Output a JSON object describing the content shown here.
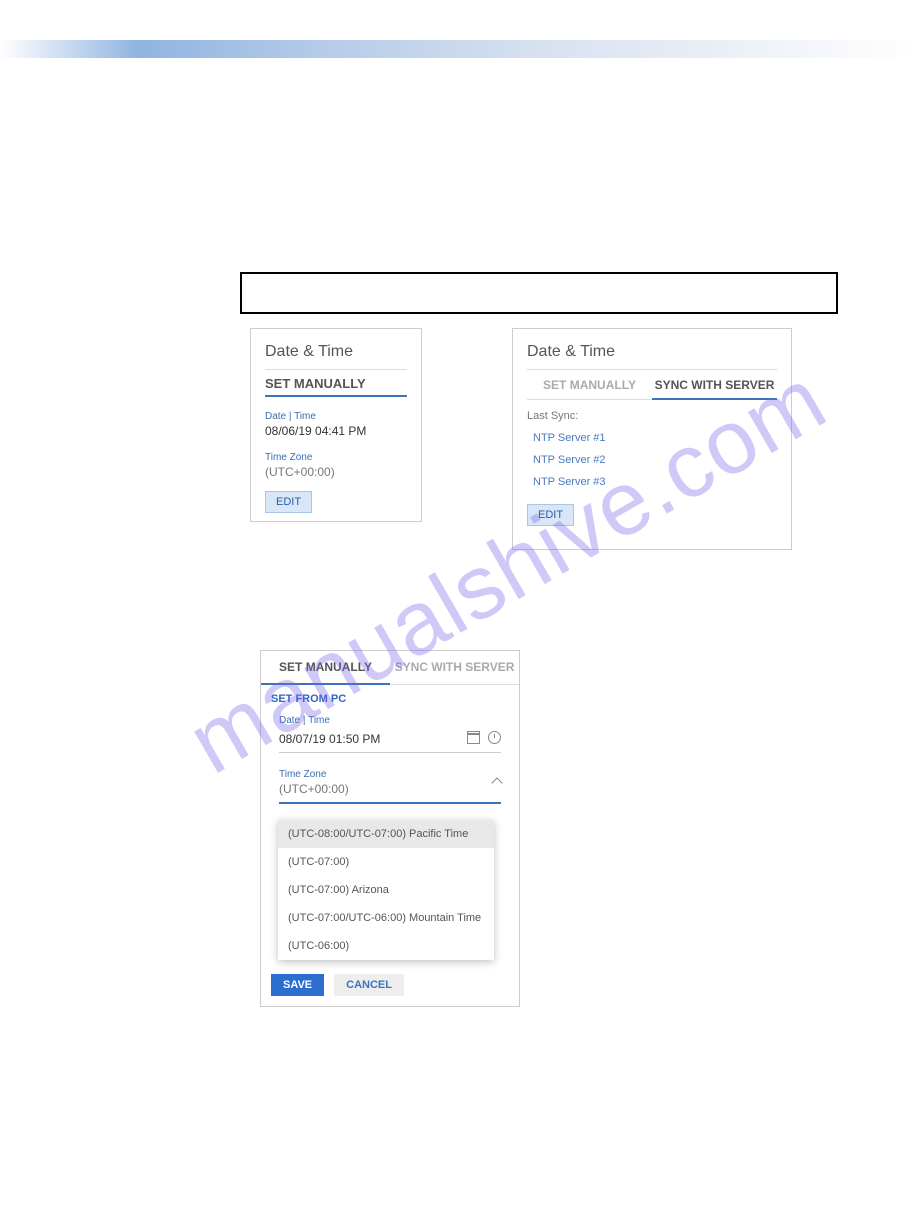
{
  "watermark": "manualshive.com",
  "panel1": {
    "title": "Date & Time",
    "tab_label": "SET MANUALLY",
    "date_label": "Date | Time",
    "date_value": "08/06/19 04:41 PM",
    "tz_label": "Time Zone",
    "tz_value": "(UTC+00:00)",
    "edit": "EDIT"
  },
  "panel2": {
    "title": "Date & Time",
    "tab_manual": "SET MANUALLY",
    "tab_sync": "SYNC WITH SERVER",
    "last_sync": "Last Sync:",
    "ntp1": "NTP Server #1",
    "ntp2": "NTP Server #2",
    "ntp3": "NTP Server #3",
    "edit": "EDIT"
  },
  "panel3": {
    "tab_manual": "SET MANUALLY",
    "tab_sync": "SYNC WITH SERVER",
    "set_from_pc": "SET FROM PC",
    "date_label": "Date | Time",
    "date_value": "08/07/19 01:50 PM",
    "tz_label": "Time Zone",
    "tz_value": "(UTC+00:00)",
    "save": "SAVE",
    "cancel": "CANCEL"
  },
  "dropdown": {
    "opt1": "(UTC-08:00/UTC-07:00) Pacific Time",
    "opt2": "(UTC-07:00)",
    "opt3": "(UTC-07:00) Arizona",
    "opt4": "(UTC-07:00/UTC-06:00) Mountain Time",
    "opt5": "(UTC-06:00)"
  }
}
